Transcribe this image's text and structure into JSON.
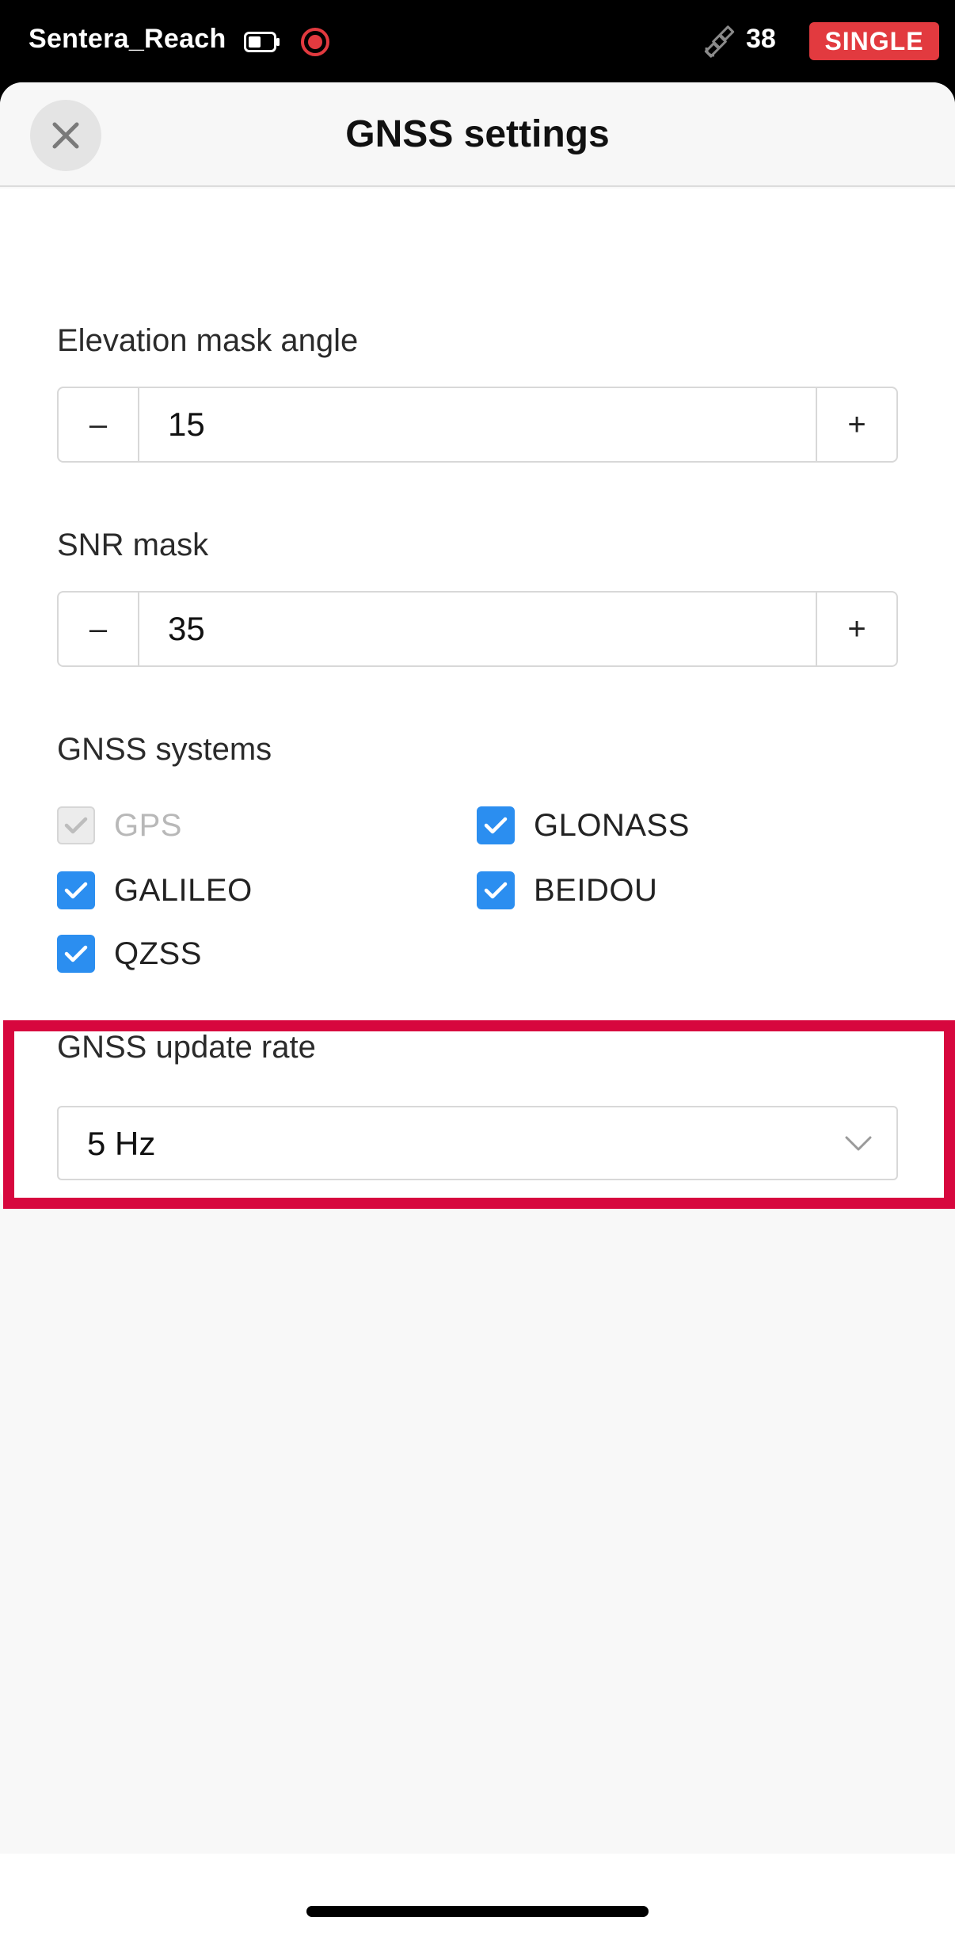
{
  "status_bar": {
    "device_name": "Sentera_Reach",
    "satellite_count": "38",
    "solution_status": "SINGLE",
    "solution_color": "#e23a3f"
  },
  "header": {
    "title": "GNSS settings",
    "close_icon": "close-icon"
  },
  "elevation_mask": {
    "label": "Elevation mask angle",
    "value": "15",
    "decrement": "–",
    "increment": "+"
  },
  "snr_mask": {
    "label": "SNR mask",
    "value": "35",
    "decrement": "–",
    "increment": "+"
  },
  "gnss_systems": {
    "label": "GNSS systems",
    "items": [
      {
        "label": "GPS",
        "checked": true,
        "disabled": true
      },
      {
        "label": "GLONASS",
        "checked": true,
        "disabled": false
      },
      {
        "label": "GALILEO",
        "checked": true,
        "disabled": false
      },
      {
        "label": "BEIDOU",
        "checked": true,
        "disabled": false
      },
      {
        "label": "QZSS",
        "checked": true,
        "disabled": false
      }
    ]
  },
  "update_rate": {
    "label": "GNSS update rate",
    "selected": "5 Hz",
    "highlight_color": "#d7073e"
  },
  "accent_color": "#2b8ef0"
}
